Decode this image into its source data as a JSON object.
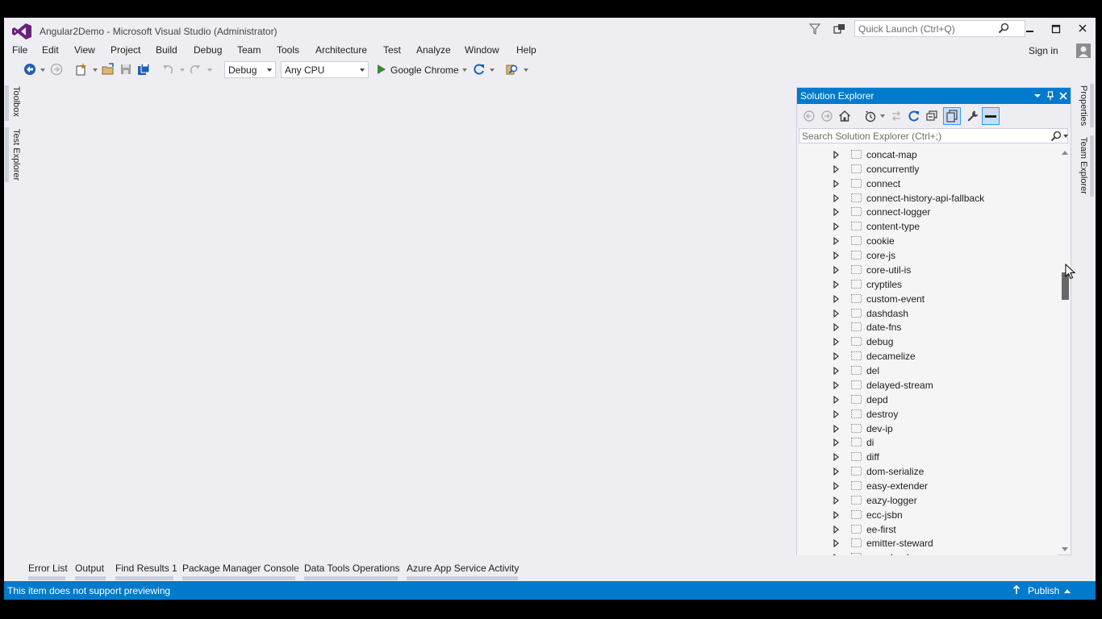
{
  "window": {
    "title": "Angular2Demo - Microsoft Visual Studio (Administrator)",
    "quick_launch_placeholder": "Quick Launch (Ctrl+Q)",
    "sign_in": "Sign in"
  },
  "menu": {
    "items": [
      "File",
      "Edit",
      "View",
      "Project",
      "Build",
      "Debug",
      "Team",
      "Tools",
      "Architecture",
      "Test",
      "Analyze",
      "Window",
      "Help"
    ]
  },
  "toolbar": {
    "configuration": "Debug",
    "platform": "Any CPU",
    "run_target": "Google Chrome"
  },
  "left_tabs": [
    "Toolbox",
    "Test Explorer"
  ],
  "right_tabs": [
    "Properties",
    "Team Explorer"
  ],
  "solution_explorer": {
    "title": "Solution Explorer",
    "search_placeholder": "Search Solution Explorer (Ctrl+;)",
    "items": [
      "concat-map",
      "concurrently",
      "connect",
      "connect-history-api-fallback",
      "connect-logger",
      "content-type",
      "cookie",
      "core-js",
      "core-util-is",
      "cryptiles",
      "custom-event",
      "dashdash",
      "date-fns",
      "debug",
      "decamelize",
      "del",
      "delayed-stream",
      "depd",
      "destroy",
      "dev-ip",
      "di",
      "diff",
      "dom-serialize",
      "easy-extender",
      "eazy-logger",
      "ecc-jsbn",
      "ee-first",
      "emitter-steward",
      "encodeurl"
    ],
    "scroll_position": 0.32
  },
  "bottom_tabs": [
    "Error List",
    "Output",
    "Find Results 1",
    "Package Manager Console",
    "Data Tools Operations",
    "Azure App Service Activity"
  ],
  "status": {
    "message": "This item does not support previewing",
    "publish": "Publish"
  },
  "colors": {
    "accent": "#007acc",
    "chrome": "#eeeef2",
    "logo": "#68217a",
    "run_green": "#388a34"
  }
}
